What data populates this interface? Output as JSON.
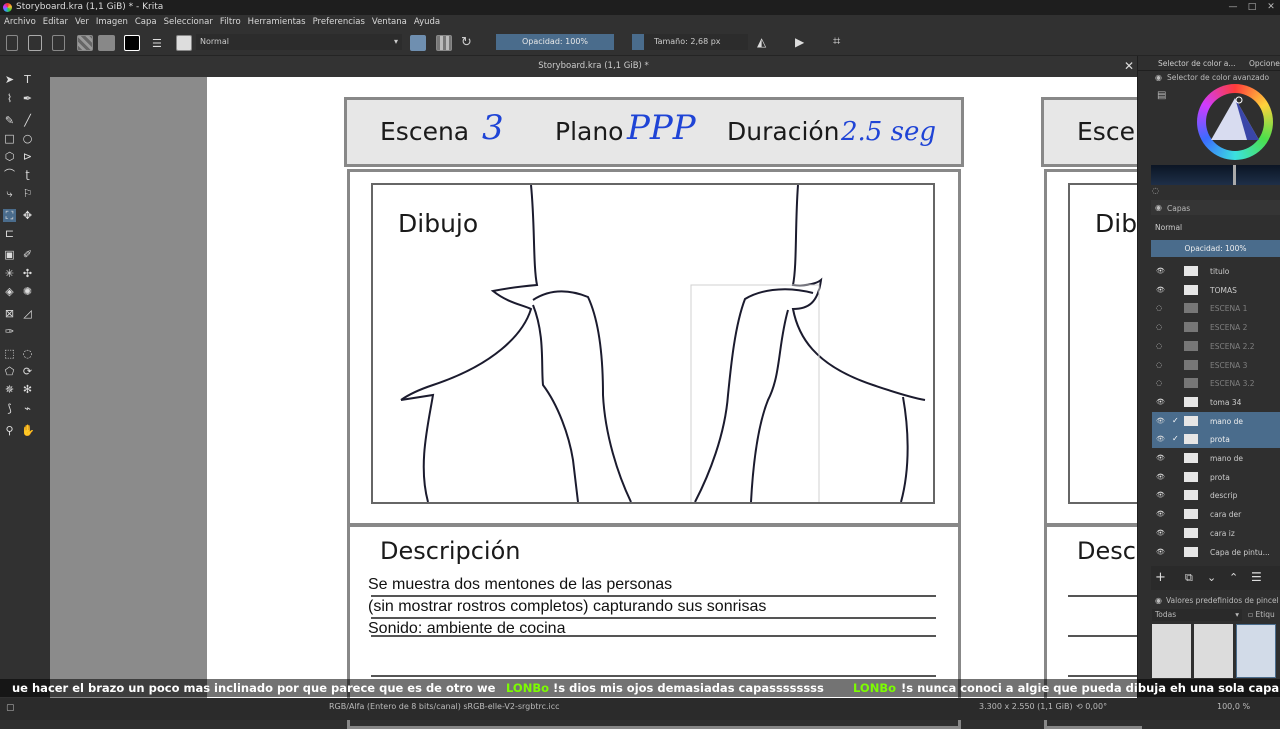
{
  "window": {
    "title": "Storyboard.kra (1,1 GiB) * - Krita"
  },
  "menu": [
    "Archivo",
    "Editar",
    "Ver",
    "Imagen",
    "Capa",
    "Seleccionar",
    "Filtro",
    "Herramientas",
    "Preferencias",
    "Ventana",
    "Ayuda"
  ],
  "toolbar": {
    "blend_mode": "Normal",
    "opacity": "Opacidad: 100%",
    "size": "Tamaño: 2,68 px"
  },
  "canvas": {
    "tab_title": "Storyboard.kra (1,1 GiB) *"
  },
  "storyboard": {
    "escena_label": "Escena",
    "escena_value": "3",
    "plano_label": "Plano",
    "plano_value": "PPP",
    "duracion_label": "Duración",
    "duracion_value": "2.5 seg",
    "dibujo_label": "Dibujo",
    "descripcion_label": "Descripción",
    "desc_lines": [
      "Se muestra dos mentones de las personas",
      "(sin mostrar rostros completos) capturando sus sonrisas",
      "Sonido: ambiente de cocina"
    ],
    "next_escena": "Esce",
    "next_dibujo": "Dib",
    "next_desc": "Desc"
  },
  "docker": {
    "tab1": "Selector de color a...",
    "tab2": "Opcione",
    "color_selector_title": "Selector de color avanzado",
    "layers_title": "Capas",
    "layers_mode": "Normal",
    "layers_opacity": "Opacidad:  100%",
    "brushes_title": "Valores predefinidos de pincel",
    "brushes_filter": "Todas",
    "brushes_tag": "Etiqu"
  },
  "layers": [
    {
      "name": "titulo",
      "dim": false,
      "selected": false
    },
    {
      "name": "TOMAS",
      "dim": false,
      "selected": false
    },
    {
      "name": "ESCENA 1",
      "dim": true,
      "selected": false
    },
    {
      "name": "ESCENA 2",
      "dim": true,
      "selected": false
    },
    {
      "name": "ESCENA 2.2",
      "dim": true,
      "selected": false
    },
    {
      "name": "ESCENA 3",
      "dim": true,
      "selected": false
    },
    {
      "name": "ESCENA 3.2",
      "dim": true,
      "selected": false
    },
    {
      "name": "toma 34",
      "dim": false,
      "selected": false
    },
    {
      "name": "mano de",
      "dim": false,
      "selected": true
    },
    {
      "name": "prota",
      "dim": false,
      "selected": true
    },
    {
      "name": "mano de",
      "dim": false,
      "selected": false
    },
    {
      "name": "prota",
      "dim": false,
      "selected": false
    },
    {
      "name": "descrip",
      "dim": false,
      "selected": false
    },
    {
      "name": "cara der",
      "dim": false,
      "selected": false
    },
    {
      "name": "cara iz",
      "dim": false,
      "selected": false
    },
    {
      "name": "Capa de pintu...",
      "dim": false,
      "selected": false
    }
  ],
  "subtitles": {
    "line1": "ue hacer el brazo un poco mas inclinado por que parece que es de otro we",
    "user2": "LONBo",
    "msg2": "!s dios mis ojos demasiadas capassssssss",
    "user3": "LONBo",
    "msg3": "!s nunca conoci a algie que pueda dibuja eh una sola capa"
  },
  "statusbar": {
    "color_info": "RGB/Alfa (Entero de 8 bits/canal)  sRGB-elle-V2-srgbtrc.icc",
    "dimensions": "3.300 x 2.550 (1,1 GiB)",
    "rotation": "0,00°",
    "zoom": "100,0 %"
  },
  "colors": {
    "accent": "#4a6c8c",
    "handwriting": "#1f44d6",
    "username": "#7CFC00"
  }
}
